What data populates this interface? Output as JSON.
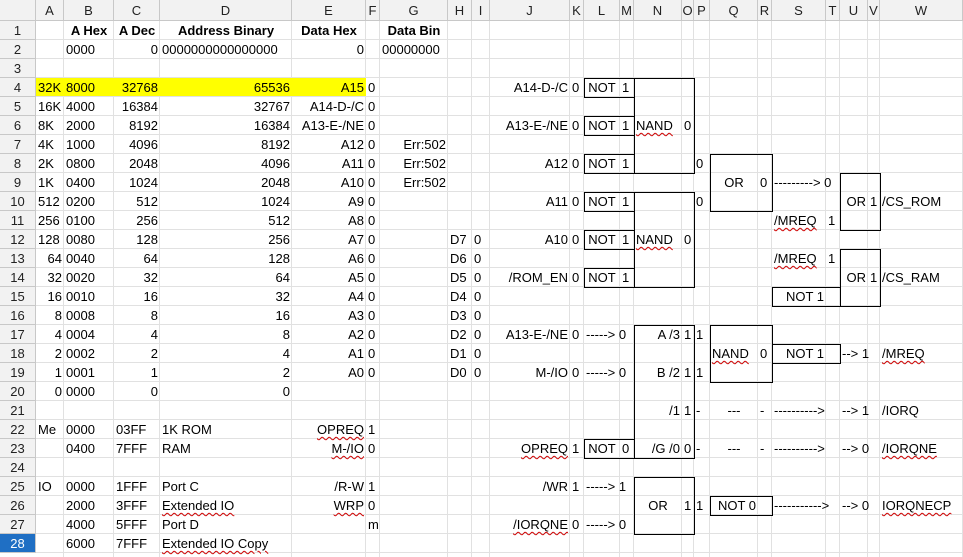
{
  "columns": [
    "A",
    "B",
    "C",
    "D",
    "E",
    "F",
    "G",
    "H",
    "I",
    "J",
    "K",
    "L",
    "M",
    "N",
    "O",
    "P",
    "Q",
    "R",
    "S",
    "T",
    "U",
    "V",
    "W"
  ],
  "rows": [
    "1",
    "2",
    "3",
    "4",
    "5",
    "6",
    "7",
    "8",
    "9",
    "10",
    "11",
    "12",
    "13",
    "14",
    "15",
    "16",
    "17",
    "18",
    "19",
    "20",
    "21",
    "22",
    "23",
    "24",
    "25",
    "26",
    "27",
    "28"
  ],
  "selected_row": "28",
  "highlight_color": "#ffff00",
  "cells": [
    [
      "B1",
      "A Hex",
      "c b"
    ],
    [
      "C1",
      "A Dec",
      "c b"
    ],
    [
      "D1",
      "Address Binary",
      "c b"
    ],
    [
      "E1",
      "Data Hex",
      "c b"
    ],
    [
      "G1",
      "Data Bin",
      "c b"
    ],
    [
      "B2",
      "0000",
      ""
    ],
    [
      "C2",
      "0",
      "r"
    ],
    [
      "D2",
      "0000000000000000",
      ""
    ],
    [
      "E2",
      "0",
      "r"
    ],
    [
      "G2",
      "00000000",
      ""
    ],
    [
      "A4",
      "32K",
      ""
    ],
    [
      "B4",
      "8000",
      ""
    ],
    [
      "C4",
      "32768",
      "r"
    ],
    [
      "D4",
      "65536",
      "r"
    ],
    [
      "E4",
      "A15",
      "r"
    ],
    [
      "F4",
      "0",
      ""
    ],
    [
      "A5",
      "16K",
      ""
    ],
    [
      "B5",
      "4000",
      ""
    ],
    [
      "C5",
      "16384",
      "r"
    ],
    [
      "D5",
      "32767",
      "r"
    ],
    [
      "E5",
      "A14-D-/C",
      "r"
    ],
    [
      "F5",
      "0",
      ""
    ],
    [
      "A6",
      "8K",
      ""
    ],
    [
      "B6",
      "2000",
      ""
    ],
    [
      "C6",
      "8192",
      "r"
    ],
    [
      "D6",
      "16384",
      "r"
    ],
    [
      "E6",
      "A13-E-/NE",
      "r"
    ],
    [
      "F6",
      "0",
      ""
    ],
    [
      "A7",
      "4K",
      ""
    ],
    [
      "B7",
      "1000",
      ""
    ],
    [
      "C7",
      "4096",
      "r"
    ],
    [
      "D7",
      "8192",
      "r"
    ],
    [
      "E7",
      "A12",
      "r"
    ],
    [
      "F7",
      "0",
      ""
    ],
    [
      "G7",
      "Err:502",
      "r"
    ],
    [
      "A8",
      "2K",
      ""
    ],
    [
      "B8",
      "0800",
      ""
    ],
    [
      "C8",
      "2048",
      "r"
    ],
    [
      "D8",
      "4096",
      "r"
    ],
    [
      "E8",
      "A11",
      "r"
    ],
    [
      "F8",
      "0",
      ""
    ],
    [
      "G8",
      "Err:502",
      "r"
    ],
    [
      "A9",
      "1K",
      ""
    ],
    [
      "B9",
      "0400",
      ""
    ],
    [
      "C9",
      "1024",
      "r"
    ],
    [
      "D9",
      "2048",
      "r"
    ],
    [
      "E9",
      "A10",
      "r"
    ],
    [
      "F9",
      "0",
      ""
    ],
    [
      "G9",
      "Err:502",
      "r"
    ],
    [
      "A10",
      "512",
      ""
    ],
    [
      "B10",
      "0200",
      ""
    ],
    [
      "C10",
      "512",
      "r"
    ],
    [
      "D10",
      "1024",
      "r"
    ],
    [
      "E10",
      "A9",
      "r"
    ],
    [
      "F10",
      "0",
      ""
    ],
    [
      "A11",
      "256",
      ""
    ],
    [
      "B11",
      "0100",
      ""
    ],
    [
      "C11",
      "256",
      "r"
    ],
    [
      "D11",
      "512",
      "r"
    ],
    [
      "E11",
      "A8",
      "r"
    ],
    [
      "F11",
      "0",
      ""
    ],
    [
      "A12",
      "128",
      ""
    ],
    [
      "B12",
      "0080",
      ""
    ],
    [
      "C12",
      "128",
      "r"
    ],
    [
      "D12",
      "256",
      "r"
    ],
    [
      "E12",
      "A7",
      "r"
    ],
    [
      "F12",
      "0",
      ""
    ],
    [
      "H12",
      "D7",
      ""
    ],
    [
      "I12",
      "0",
      ""
    ],
    [
      "A13",
      "64",
      "r"
    ],
    [
      "B13",
      "0040",
      ""
    ],
    [
      "C13",
      "64",
      "r"
    ],
    [
      "D13",
      "128",
      "r"
    ],
    [
      "E13",
      "A6",
      "r"
    ],
    [
      "F13",
      "0",
      ""
    ],
    [
      "H13",
      "D6",
      ""
    ],
    [
      "I13",
      "0",
      ""
    ],
    [
      "A14",
      "32",
      "r"
    ],
    [
      "B14",
      "0020",
      ""
    ],
    [
      "C14",
      "32",
      "r"
    ],
    [
      "D14",
      "64",
      "r"
    ],
    [
      "E14",
      "A5",
      "r"
    ],
    [
      "F14",
      "0",
      ""
    ],
    [
      "H14",
      "D5",
      ""
    ],
    [
      "I14",
      "0",
      ""
    ],
    [
      "A15",
      "16",
      "r"
    ],
    [
      "B15",
      "0010",
      ""
    ],
    [
      "C15",
      "16",
      "r"
    ],
    [
      "D15",
      "32",
      "r"
    ],
    [
      "E15",
      "A4",
      "r"
    ],
    [
      "F15",
      "0",
      ""
    ],
    [
      "H15",
      "D4",
      ""
    ],
    [
      "I15",
      "0",
      ""
    ],
    [
      "A16",
      "8",
      "r"
    ],
    [
      "B16",
      "0008",
      ""
    ],
    [
      "C16",
      "8",
      "r"
    ],
    [
      "D16",
      "16",
      "r"
    ],
    [
      "E16",
      "A3",
      "r"
    ],
    [
      "F16",
      "0",
      ""
    ],
    [
      "H16",
      "D3",
      ""
    ],
    [
      "I16",
      "0",
      ""
    ],
    [
      "A17",
      "4",
      "r"
    ],
    [
      "B17",
      "0004",
      ""
    ],
    [
      "C17",
      "4",
      "r"
    ],
    [
      "D17",
      "8",
      "r"
    ],
    [
      "E17",
      "A2",
      "r"
    ],
    [
      "F17",
      "0",
      ""
    ],
    [
      "H17",
      "D2",
      ""
    ],
    [
      "I17",
      "0",
      ""
    ],
    [
      "A18",
      "2",
      "r"
    ],
    [
      "B18",
      "0002",
      ""
    ],
    [
      "C18",
      "2",
      "r"
    ],
    [
      "D18",
      "4",
      "r"
    ],
    [
      "E18",
      "A1",
      "r"
    ],
    [
      "F18",
      "0",
      ""
    ],
    [
      "H18",
      "D1",
      ""
    ],
    [
      "I18",
      "0",
      ""
    ],
    [
      "A19",
      "1",
      "r"
    ],
    [
      "B19",
      "0001",
      ""
    ],
    [
      "C19",
      "1",
      "r"
    ],
    [
      "D19",
      "2",
      "r"
    ],
    [
      "E19",
      "A0",
      "r"
    ],
    [
      "F19",
      "0",
      ""
    ],
    [
      "H19",
      "D0",
      ""
    ],
    [
      "I19",
      "0",
      ""
    ],
    [
      "A20",
      "0",
      "r"
    ],
    [
      "B20",
      "0000",
      ""
    ],
    [
      "C20",
      "0",
      "r"
    ],
    [
      "D20",
      "0",
      "r"
    ],
    [
      "A22",
      "Me",
      ""
    ],
    [
      "B22",
      "0000",
      ""
    ],
    [
      "C22",
      "03FF",
      ""
    ],
    [
      "D22",
      "1K ROM",
      ""
    ],
    [
      "E22",
      "OPREQ",
      "r sq"
    ],
    [
      "F22",
      "1",
      ""
    ],
    [
      "B23",
      "0400",
      ""
    ],
    [
      "C23",
      "7FFF",
      ""
    ],
    [
      "D23",
      "RAM",
      ""
    ],
    [
      "E23",
      "M-/IO",
      "r sq"
    ],
    [
      "F23",
      "0",
      ""
    ],
    [
      "A25",
      "IO",
      ""
    ],
    [
      "B25",
      "0000",
      ""
    ],
    [
      "C25",
      "1FFF",
      ""
    ],
    [
      "D25",
      "Port C",
      ""
    ],
    [
      "E25",
      "/R-W",
      "r"
    ],
    [
      "F25",
      "1",
      ""
    ],
    [
      "B26",
      "2000",
      ""
    ],
    [
      "C26",
      "3FFF",
      ""
    ],
    [
      "D26",
      "Extended IO",
      "sq"
    ],
    [
      "E26",
      "WRP",
      "r sq"
    ],
    [
      "F26",
      "0",
      ""
    ],
    [
      "B27",
      "4000",
      ""
    ],
    [
      "C27",
      "5FFF",
      ""
    ],
    [
      "D27",
      "Port D",
      ""
    ],
    [
      "F27",
      "m",
      ""
    ],
    [
      "B28",
      "6000",
      ""
    ],
    [
      "C28",
      "7FFF",
      ""
    ],
    [
      "D28",
      "Extended IO Copy",
      "sq"
    ],
    [
      "J4",
      "A14-D-/C",
      "r"
    ],
    [
      "K4",
      "0",
      ""
    ],
    [
      "L4",
      "NOT",
      "c"
    ],
    [
      "M4",
      "1",
      ""
    ],
    [
      "J6",
      "A13-E-/NE",
      "r"
    ],
    [
      "K6",
      "0",
      ""
    ],
    [
      "L6",
      "NOT",
      "c"
    ],
    [
      "M6",
      "1",
      ""
    ],
    [
      "N6",
      "NAND",
      "sq"
    ],
    [
      "O6",
      "0",
      ""
    ],
    [
      "J8",
      "A12",
      "r"
    ],
    [
      "K8",
      "0",
      ""
    ],
    [
      "L8",
      "NOT",
      "c"
    ],
    [
      "M8",
      "1",
      ""
    ],
    [
      "P8",
      "0",
      ""
    ],
    [
      "Q9",
      "OR",
      "c"
    ],
    [
      "R9",
      "0",
      ""
    ],
    [
      "S9",
      "---------> 0",
      "r"
    ],
    [
      "J10",
      "A11",
      "r"
    ],
    [
      "K10",
      "0",
      ""
    ],
    [
      "L10",
      "NOT",
      "c"
    ],
    [
      "M10",
      "1",
      ""
    ],
    [
      "P10",
      "0",
      ""
    ],
    [
      "U10",
      "OR",
      "r"
    ],
    [
      "V10",
      "1",
      ""
    ],
    [
      "W10",
      "/CS_ROM",
      ""
    ],
    [
      "S11",
      "/MREQ",
      "sq"
    ],
    [
      "T11",
      "1",
      ""
    ],
    [
      "J12",
      "A10",
      "r"
    ],
    [
      "K12",
      "0",
      ""
    ],
    [
      "L12",
      "NOT",
      "c"
    ],
    [
      "M12",
      "1",
      ""
    ],
    [
      "N12",
      "NAND",
      "sq"
    ],
    [
      "O12",
      "0",
      ""
    ],
    [
      "S13",
      "/MREQ",
      "sq"
    ],
    [
      "T13",
      "1",
      ""
    ],
    [
      "J14",
      "/ROM_EN",
      "r"
    ],
    [
      "K14",
      "0",
      ""
    ],
    [
      "L14",
      "NOT",
      "c"
    ],
    [
      "M14",
      "1",
      ""
    ],
    [
      "U14",
      "OR",
      "r"
    ],
    [
      "V14",
      "1",
      ""
    ],
    [
      "W14",
      "/CS_RAM",
      ""
    ],
    [
      "S15",
      "NOT 1",
      "r"
    ],
    [
      "J17",
      "A13-E-/NE",
      "r"
    ],
    [
      "K17",
      "0",
      ""
    ],
    [
      "L17",
      "-----> 0",
      "r"
    ],
    [
      "N17",
      "A    /3",
      "r"
    ],
    [
      "O17",
      "1",
      ""
    ],
    [
      "P17",
      "1",
      ""
    ],
    [
      "Q18",
      "NAND",
      "sq"
    ],
    [
      "R18",
      "0",
      ""
    ],
    [
      "S18",
      "NOT 1",
      "r"
    ],
    [
      "U18",
      "--> 1",
      "r"
    ],
    [
      "W18",
      "/MREQ",
      "sq"
    ],
    [
      "J19",
      "M-/IO",
      "r"
    ],
    [
      "K19",
      "0",
      ""
    ],
    [
      "L19",
      "-----> 0",
      "r"
    ],
    [
      "N19",
      "B    /2",
      "r"
    ],
    [
      "O19",
      "1",
      ""
    ],
    [
      "P19",
      "1",
      ""
    ],
    [
      "N21",
      "/1",
      "r"
    ],
    [
      "O21",
      "1",
      ""
    ],
    [
      "P21",
      "-",
      ""
    ],
    [
      "Q21",
      "---",
      "c"
    ],
    [
      "R21",
      "-",
      ""
    ],
    [
      "S21",
      "---------->",
      "r"
    ],
    [
      "U21",
      "--> 1",
      "r"
    ],
    [
      "W21",
      "/IORQ",
      ""
    ],
    [
      "J23",
      "OPREQ",
      "r sq"
    ],
    [
      "K23",
      "1",
      ""
    ],
    [
      "L23",
      "NOT",
      "c"
    ],
    [
      "M23",
      "0",
      ""
    ],
    [
      "N23",
      "/G   /0",
      "r"
    ],
    [
      "O23",
      "0",
      ""
    ],
    [
      "P23",
      "-",
      ""
    ],
    [
      "Q23",
      "---",
      "c"
    ],
    [
      "R23",
      "-",
      ""
    ],
    [
      "S23",
      "---------->",
      "r"
    ],
    [
      "U23",
      "--> 0",
      "r"
    ],
    [
      "W23",
      "/IORQNE",
      "sq"
    ],
    [
      "J25",
      "/WR",
      "r"
    ],
    [
      "K25",
      "1",
      ""
    ],
    [
      "L25",
      "-----> 1",
      "r"
    ],
    [
      "N26",
      "OR",
      "c"
    ],
    [
      "O26",
      "1",
      ""
    ],
    [
      "P26",
      "1",
      ""
    ],
    [
      "Q26",
      "NOT 0",
      "r"
    ],
    [
      "S26",
      "----------->",
      "r"
    ],
    [
      "U26",
      "--> 0",
      "r"
    ],
    [
      "W26",
      "IORQNECP",
      "sq"
    ],
    [
      "J27",
      "/IORQNE",
      "r sq"
    ],
    [
      "K27",
      "0",
      ""
    ],
    [
      "L27",
      "-----> 0",
      "r"
    ]
  ]
}
